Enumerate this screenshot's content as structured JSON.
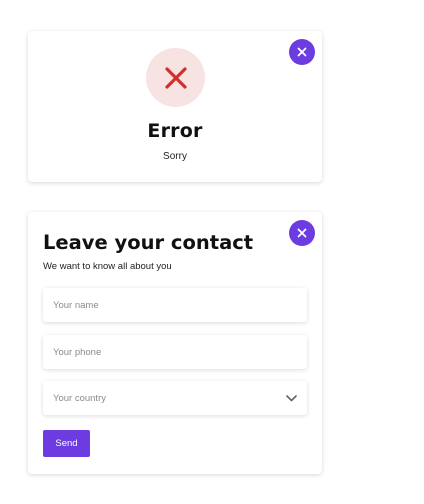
{
  "colors": {
    "accent": "#6c3ce1",
    "error_red": "#d32f2f",
    "error_bg": "#f8e3e3"
  },
  "error_card": {
    "icon": "close-x-icon",
    "title": "Error",
    "subtitle": "Sorry",
    "close_icon": "close-icon"
  },
  "contact_card": {
    "title": "Leave your contact",
    "subtitle": "We want to know all about you",
    "close_icon": "close-icon",
    "fields": {
      "name_placeholder": "Your name",
      "phone_placeholder": "Your phone",
      "country_placeholder": "Your country"
    },
    "country_icon": "chevron-down-icon",
    "send_label": "Send"
  }
}
